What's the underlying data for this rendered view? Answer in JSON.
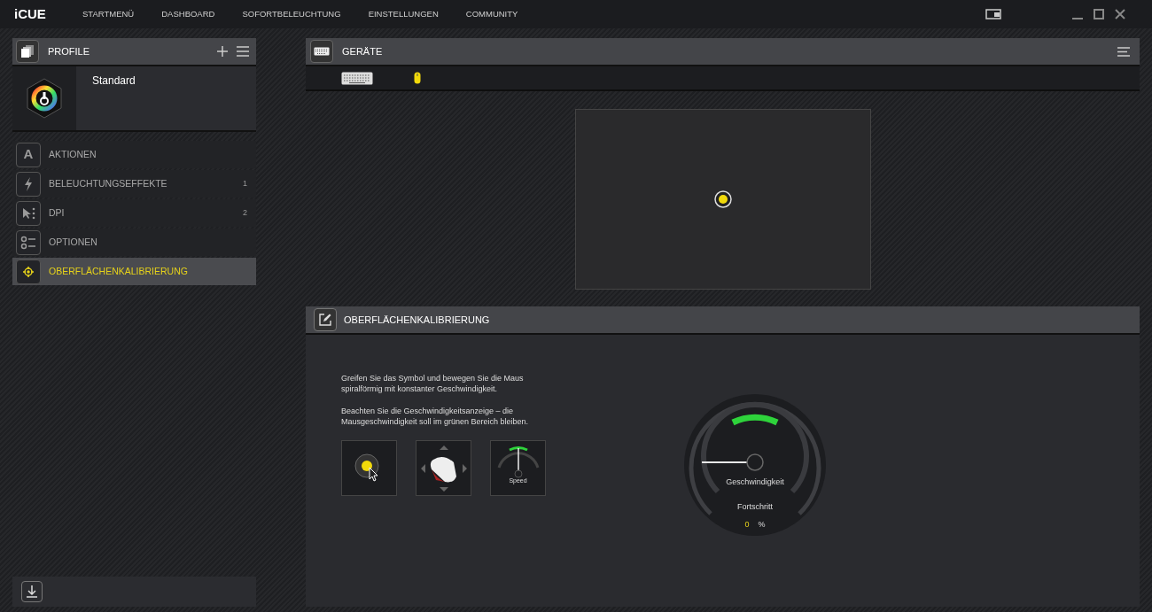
{
  "app": {
    "logo": "iCUE"
  },
  "nav": [
    {
      "label": "STARTMENÜ",
      "selected": false
    },
    {
      "label": "DASHBOARD",
      "selected": false
    },
    {
      "label": "SOFORTBELEUCHTUNG",
      "selected": false
    },
    {
      "label": "EINSTELLUNGEN",
      "selected": false
    },
    {
      "label": "COMMUNITY",
      "selected": false
    }
  ],
  "profiles": {
    "title": "PROFILE",
    "current": "Standard"
  },
  "sidebar": {
    "items": [
      {
        "label": "AKTIONEN",
        "icon_text": "A",
        "selected": false
      },
      {
        "label": "BELEUCHTUNGSEFFEKTE",
        "count": "1",
        "selected": false
      },
      {
        "label": "DPI",
        "count": "2",
        "selected": false
      },
      {
        "label": "OPTIONEN",
        "selected": false
      },
      {
        "label": "OBERFLÄCHENKALIBRIERUNG",
        "selected": true
      }
    ]
  },
  "devices": {
    "title": "GERÄTE",
    "items": [
      {
        "kind": "keyboard",
        "selected": false
      },
      {
        "kind": "mouse",
        "selected": true
      }
    ]
  },
  "calibration": {
    "title": "OBERFLÄCHENKALIBRIERUNG",
    "instructions": [
      "Greifen Sie das Symbol und bewegen Sie die Maus spiralförmig mit konstanter Geschwindigkeit.",
      "Beachten Sie die Geschwindigkeitsanzeige – die Mausgeschwindigkeit soll im grünen Bereich bleiben."
    ],
    "speed_label": "Speed",
    "gauge_label": "Geschwindigkeit",
    "progress_label": "Fortschritt",
    "progress_value": "0",
    "progress_unit": "%"
  }
}
